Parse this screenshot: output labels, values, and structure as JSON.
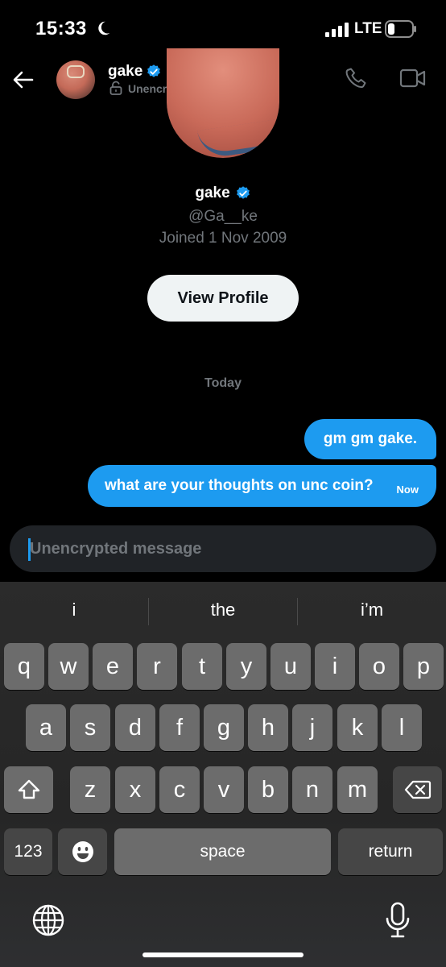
{
  "status_bar": {
    "time": "15:33",
    "network": "LTE",
    "icons": [
      "moon-icon",
      "signal-icon",
      "battery-icon"
    ]
  },
  "header": {
    "name": "gake",
    "encryption": "Unencrypted",
    "icons": [
      "back-icon",
      "verified-icon",
      "lock-icon",
      "phone-icon",
      "video-icon"
    ]
  },
  "profile": {
    "name": "gake",
    "handle": "@Ga__ke",
    "joined": "Joined 1 Nov 2009",
    "view_profile_label": "View Profile"
  },
  "conversation": {
    "date_label": "Today",
    "messages": [
      {
        "text": "gm gm gake.",
        "time": ""
      },
      {
        "text": "what are your thoughts on unc coin?",
        "time": "Now"
      }
    ]
  },
  "composer": {
    "placeholder": "Unencrypted message"
  },
  "keyboard": {
    "suggestions": [
      "i",
      "the",
      "i’m"
    ],
    "row1": [
      "q",
      "w",
      "e",
      "r",
      "t",
      "y",
      "u",
      "i",
      "o",
      "p"
    ],
    "row2": [
      "a",
      "s",
      "d",
      "f",
      "g",
      "h",
      "j",
      "k",
      "l"
    ],
    "row3": [
      "z",
      "x",
      "c",
      "v",
      "b",
      "n",
      "m"
    ],
    "numbers_label": "123",
    "space_label": "space",
    "return_label": "return",
    "icons": [
      "shift-icon",
      "delete-icon",
      "emoji-icon",
      "globe-icon",
      "microphone-icon"
    ]
  },
  "colors": {
    "accent": "#1d9bf0",
    "background": "#000000",
    "muted_text": "#71767b"
  }
}
